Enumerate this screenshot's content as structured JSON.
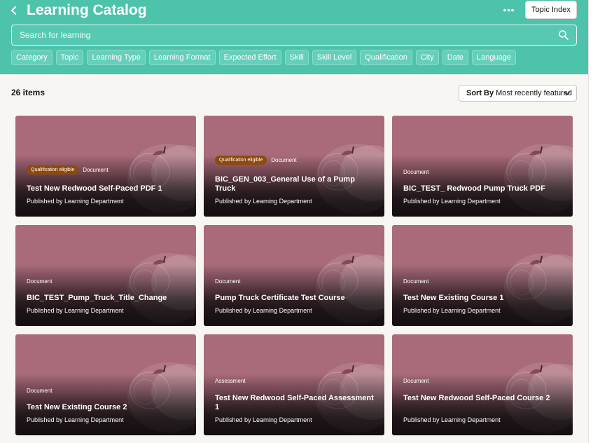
{
  "header": {
    "title": "Learning Catalog",
    "back_icon": "chevron-left-icon",
    "more_icon": "ellipsis-icon",
    "topic_index_label": "Topic Index",
    "colors": {
      "header_bg": "#4dc3ac",
      "badge": "#8c4a0f",
      "card": "#a96b79"
    }
  },
  "search": {
    "placeholder": "Search for learning",
    "icon": "search-icon"
  },
  "filters": [
    "Category",
    "Topic",
    "Learning Type",
    "Learning Format",
    "Expected Effort",
    "Skill",
    "Skill Level",
    "Qualification",
    "City",
    "Date",
    "Language"
  ],
  "results": {
    "count_label": "26 items",
    "sort_prefix": "Sort By",
    "sort_value": "Most recently featured"
  },
  "cards": [
    {
      "badge": "Qualification eligible",
      "type": "Document",
      "title": "Test New Redwood Self-Paced PDF 1",
      "publisher": "Published by Learning Department"
    },
    {
      "badge": "Qualification eligible",
      "type": "Document",
      "title": "BIC_GEN_003_General Use of a Pump Truck",
      "publisher": "Published by Learning Department"
    },
    {
      "badge": "",
      "type": "Document",
      "title": "BIC_TEST_ Redwood Pump Truck PDF",
      "publisher": "Published by Learning Department"
    },
    {
      "badge": "",
      "type": "Document",
      "title": "BIC_TEST_Pump_Truck_Title_Change",
      "publisher": "Published by Learning Department"
    },
    {
      "badge": "",
      "type": "Document",
      "title": "Pump Truck Certificate Test Course",
      "publisher": "Published by Learning Department"
    },
    {
      "badge": "",
      "type": "Document",
      "title": "Test New Existing Course 1",
      "publisher": "Published by Learning Department"
    },
    {
      "badge": "",
      "type": "Document",
      "title": "Test New Existing Course 2",
      "publisher": "Published by Learning Department"
    },
    {
      "badge": "",
      "type": "Assessment",
      "title": "Test New Redwood Self-Paced Assessment 1",
      "publisher": "Published by Learning Department"
    },
    {
      "badge": "",
      "type": "Document",
      "title": "Test New Redwood Self-Paced Course 2",
      "publisher": "Published by Learning Department"
    }
  ]
}
